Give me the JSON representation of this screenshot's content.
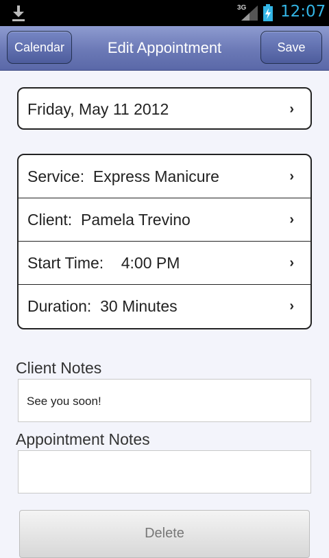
{
  "status_bar": {
    "network": "3G",
    "time": "12:07"
  },
  "header": {
    "back_label": "Calendar",
    "title": "Edit Appointment",
    "save_label": "Save"
  },
  "date_row": {
    "label": "Friday, May 11 2012"
  },
  "details": {
    "service": "Service:  Express Manicure",
    "client": "Client:  Pamela Trevino",
    "start_time": "Start Time:    4:00 PM",
    "duration": "Duration:  30 Minutes"
  },
  "client_notes": {
    "label": "Client Notes",
    "value": "See you soon!"
  },
  "appointment_notes": {
    "label": "Appointment Notes",
    "value": ""
  },
  "actions": {
    "delete_label": "Delete"
  },
  "icons": {
    "chevron": "chevron-right-icon",
    "download": "download-icon",
    "signal": "signal-icon",
    "battery": "battery-charging-icon"
  },
  "colors": {
    "accent": "#33b5e5",
    "titlebar": "#6b79b6",
    "background": "#f3f4fb"
  }
}
